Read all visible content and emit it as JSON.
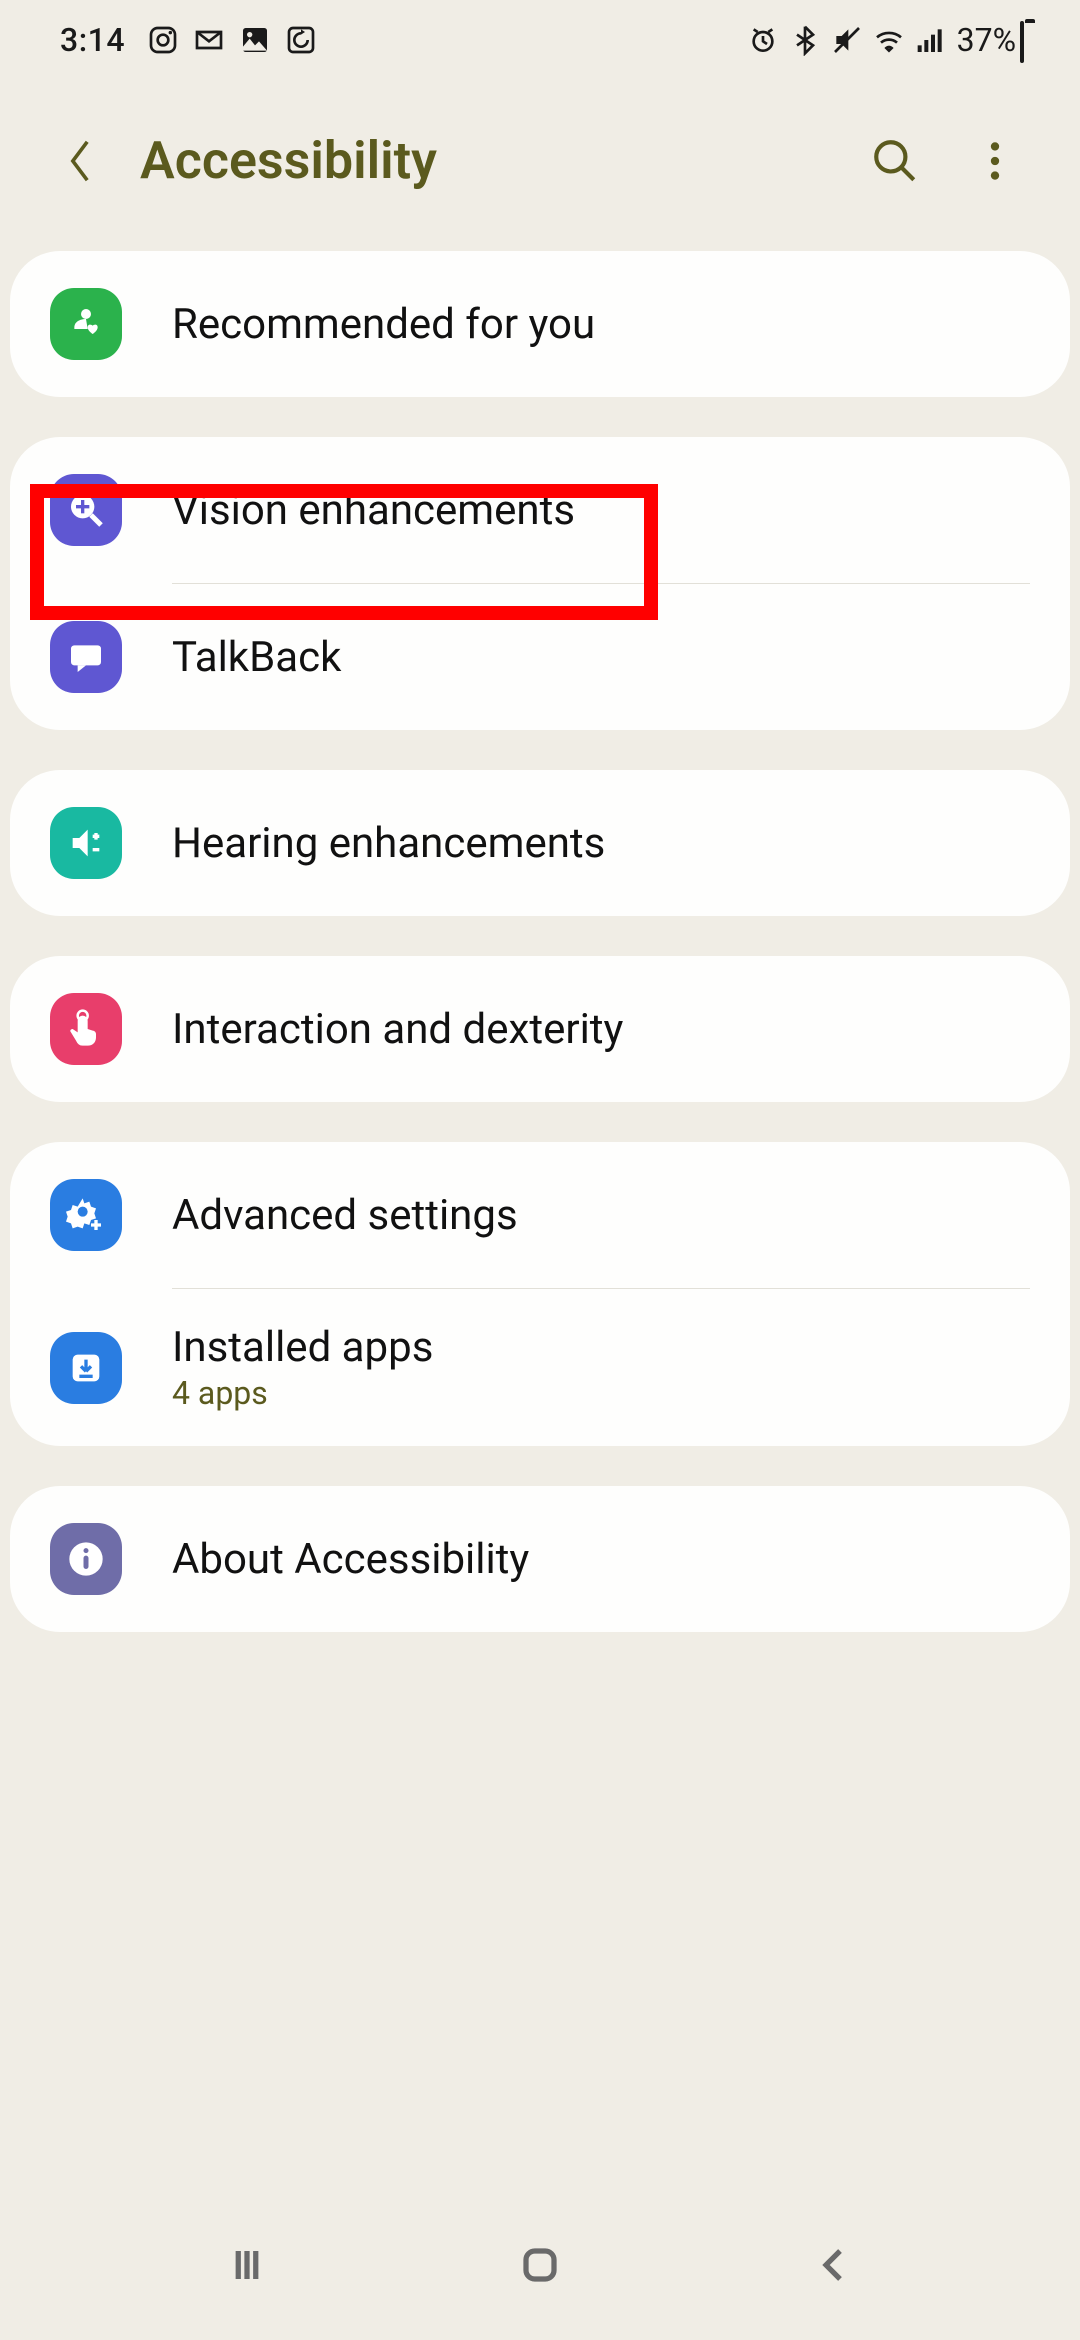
{
  "status": {
    "time": "3:14",
    "battery_pct": "37%"
  },
  "header": {
    "title": "Accessibility"
  },
  "items": {
    "recommended": {
      "label": "Recommended for you"
    },
    "vision": {
      "label": "Vision enhancements"
    },
    "talkback": {
      "label": "TalkBack"
    },
    "hearing": {
      "label": "Hearing enhancements"
    },
    "interaction": {
      "label": "Interaction and dexterity"
    },
    "advanced": {
      "label": "Advanced settings"
    },
    "installed": {
      "label": "Installed apps",
      "sub": "4 apps"
    },
    "about": {
      "label": "About Accessibility"
    }
  }
}
